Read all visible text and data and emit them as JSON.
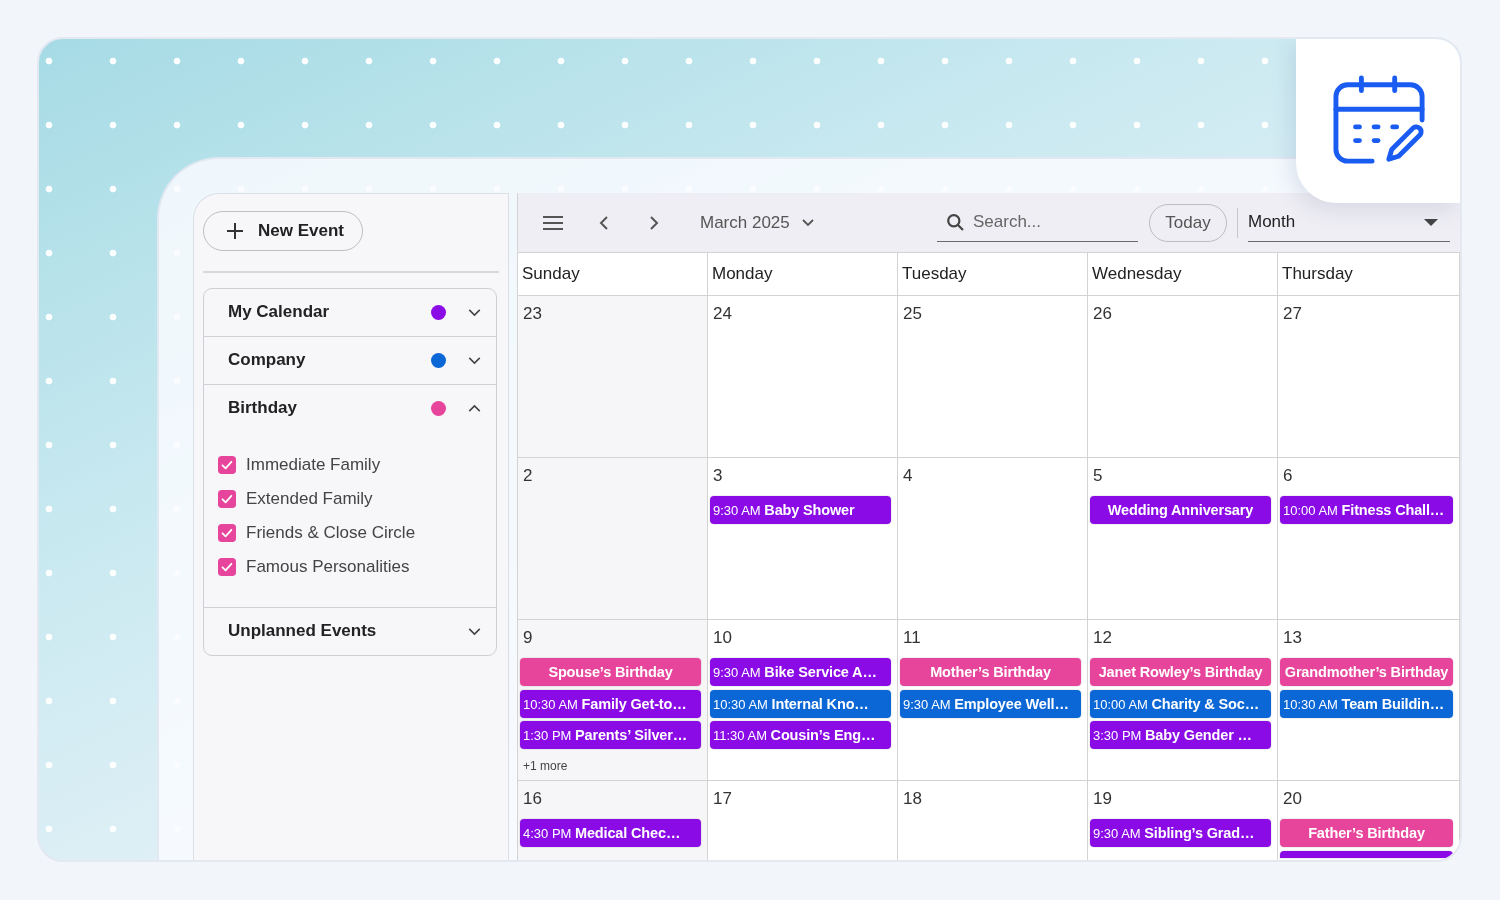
{
  "sidebar": {
    "new_event_button": {
      "label": "New Event"
    },
    "calendars": [
      {
        "name": "My Calendar",
        "color": "#8b0be6",
        "expanded": false
      },
      {
        "name": "Company",
        "color": "#0b67d6",
        "expanded": false
      },
      {
        "name": "Birthday",
        "color": "#e7459b",
        "expanded": true,
        "children": [
          {
            "label": "Immediate Family",
            "checked": true
          },
          {
            "label": "Extended Family",
            "checked": true
          },
          {
            "label": "Friends & Close Circle",
            "checked": true
          },
          {
            "label": "Famous Personalities",
            "checked": true
          }
        ]
      },
      {
        "name": "Unplanned Events",
        "expanded": false
      }
    ]
  },
  "toolbar": {
    "period": "March 2025",
    "search": {
      "placeholder": "Search..."
    },
    "today_button": {
      "label": "Today"
    },
    "view": {
      "value": "Month"
    }
  },
  "calendar": {
    "weekdays": [
      "Sunday",
      "Monday",
      "Tuesday",
      "Wednesday",
      "Thursday"
    ],
    "weeks": [
      {
        "days": [
          {
            "date": "23"
          },
          {
            "date": "24"
          },
          {
            "date": "25"
          },
          {
            "date": "26"
          },
          {
            "date": "27"
          }
        ]
      },
      {
        "days": [
          {
            "date": "2"
          },
          {
            "date": "3",
            "events": [
              {
                "time": "9:30 AM",
                "title": "Baby Shower",
                "color": "#8b0be6"
              }
            ]
          },
          {
            "date": "4"
          },
          {
            "date": "5",
            "events": [
              {
                "title": "Wedding Anniversary",
                "color": "#8b0be6"
              }
            ]
          },
          {
            "date": "6",
            "events": [
              {
                "time": "10:00 AM",
                "title": "Fitness Chall…",
                "color": "#8b0be6"
              }
            ]
          }
        ]
      },
      {
        "days": [
          {
            "date": "9",
            "events": [
              {
                "title": "Spouse’s Birthday",
                "color": "#e7459b"
              },
              {
                "time": "10:30 AM",
                "title": "Family Get-to…",
                "color": "#8b0be6"
              },
              {
                "time": "1:30 PM",
                "title": "Parents’ Silver…",
                "color": "#8b0be6"
              }
            ],
            "more": "+1 more"
          },
          {
            "date": "10",
            "events": [
              {
                "time": "9:30 AM",
                "title": "Bike Service A…",
                "color": "#8b0be6"
              },
              {
                "time": "10:30 AM",
                "title": "Internal Kno…",
                "color": "#0b67d6"
              },
              {
                "time": "11:30 AM",
                "title": "Cousin’s Eng…",
                "color": "#8b0be6"
              }
            ]
          },
          {
            "date": "11",
            "events": [
              {
                "title": "Mother’s Birthday",
                "color": "#e7459b"
              },
              {
                "time": "9:30 AM",
                "title": "Employee Well…",
                "color": "#0b67d6"
              }
            ]
          },
          {
            "date": "12",
            "events": [
              {
                "title": "Janet Rowley’s Birthday",
                "color": "#e7459b"
              },
              {
                "time": "10:00 AM",
                "title": "Charity & Soc…",
                "color": "#0b67d6"
              },
              {
                "time": "3:30 PM",
                "title": "Baby Gender …",
                "color": "#8b0be6"
              }
            ]
          },
          {
            "date": "13",
            "events": [
              {
                "title": "Grandmother’s Birthday",
                "color": "#e7459b"
              },
              {
                "time": "10:30 AM",
                "title": "Team Buildin…",
                "color": "#0b67d6"
              }
            ]
          }
        ]
      },
      {
        "days": [
          {
            "date": "16",
            "events": [
              {
                "time": "4:30 PM",
                "title": "Medical Chec…",
                "color": "#8b0be6"
              }
            ]
          },
          {
            "date": "17"
          },
          {
            "date": "18"
          },
          {
            "date": "19",
            "events": [
              {
                "time": "9:30 AM",
                "title": "Sibling’s Grad…",
                "color": "#8b0be6"
              }
            ]
          },
          {
            "date": "20",
            "events": [
              {
                "title": "Father’s Birthday",
                "color": "#e7459b"
              },
              {
                "color": "#8b0be6"
              }
            ]
          }
        ]
      }
    ]
  }
}
